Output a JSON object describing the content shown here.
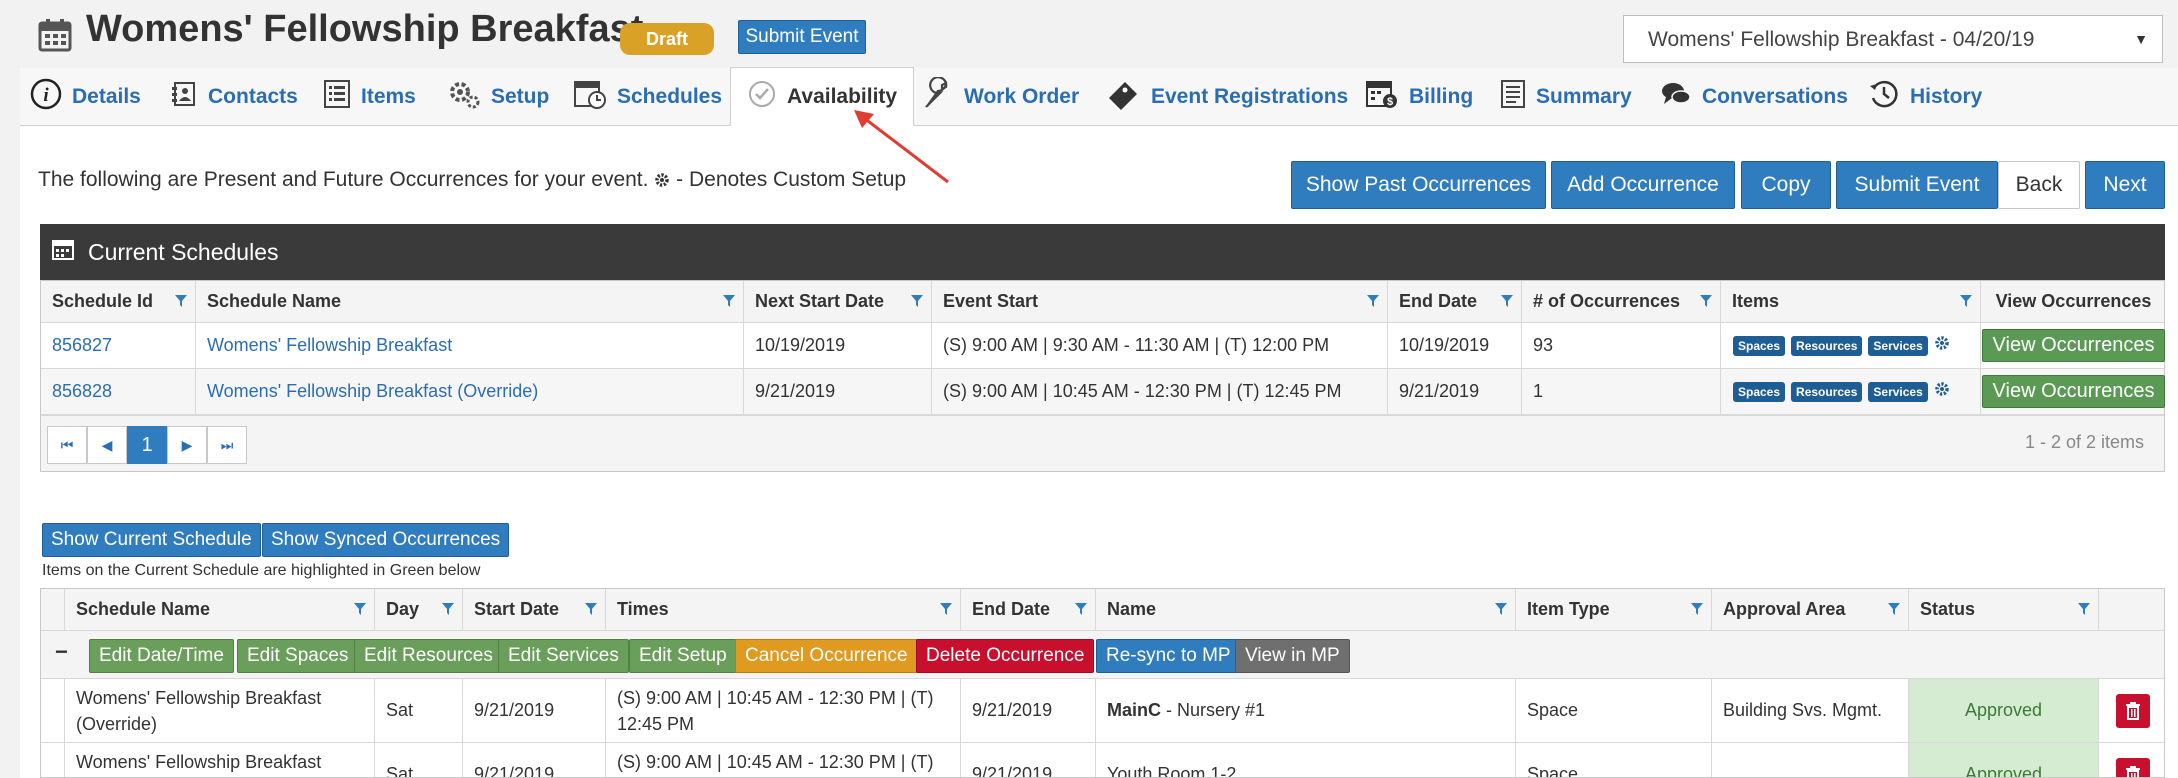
{
  "header": {
    "title": "Womens' Fellowship Breakfast",
    "badge": "Draft",
    "submit_label": "Submit Event",
    "occurrence_select": "Womens' Fellowship Breakfast - 04/20/19"
  },
  "tabs": [
    {
      "label": "Details",
      "icon": "info-icon"
    },
    {
      "label": "Contacts",
      "icon": "contacts-icon"
    },
    {
      "label": "Items",
      "icon": "list-icon"
    },
    {
      "label": "Setup",
      "icon": "gears-icon"
    },
    {
      "label": "Schedules",
      "icon": "calendar-clock-icon"
    },
    {
      "label": "Availability",
      "icon": "check-clock-icon",
      "active": true
    },
    {
      "label": "Work Order",
      "icon": "wrench-icon"
    },
    {
      "label": "Event Registrations",
      "icon": "ticket-icon"
    },
    {
      "label": "Billing",
      "icon": "calendar-dollar-icon"
    },
    {
      "label": "Summary",
      "icon": "document-icon"
    },
    {
      "label": "Conversations",
      "icon": "chat-icon"
    },
    {
      "label": "History",
      "icon": "history-icon"
    }
  ],
  "intro_text": "The following are Present and Future Occurrences for your event.",
  "intro_suffix": "- Denotes Custom Setup",
  "action_buttons": {
    "show_past": "Show Past Occurrences",
    "add": "Add Occurrence",
    "copy": "Copy",
    "submit": "Submit Event",
    "back": "Back",
    "next": "Next"
  },
  "current_schedules": {
    "title": "Current Schedules",
    "columns": [
      "Schedule Id",
      "Schedule Name",
      "Next Start Date",
      "Event Start",
      "End Date",
      "# of Occurrences",
      "Items",
      "View Occurrences"
    ],
    "item_chips": [
      "Spaces",
      "Resources",
      "Services"
    ],
    "view_label": "View Occurrences",
    "rows": [
      {
        "id": "856827",
        "name": "Womens' Fellowship Breakfast",
        "next_start": "10/19/2019",
        "event_start": "(S) 9:00 AM | 9:30 AM - 11:30 AM | (T) 12:00 PM",
        "end_date": "10/19/2019",
        "occurrences": "93"
      },
      {
        "id": "856828",
        "name": "Womens' Fellowship Breakfast (Override)",
        "next_start": "9/21/2019",
        "event_start": "(S) 9:00 AM | 10:45 AM - 12:30 PM | (T) 12:45 PM",
        "end_date": "9/21/2019",
        "occurrences": "1"
      }
    ],
    "current_page": "1",
    "items_count": "1 - 2 of 2 items"
  },
  "lower": {
    "show_current": "Show Current Schedule",
    "show_synced": "Show Synced Occurrences",
    "note": "Items on the Current Schedule are highlighted in Green below",
    "columns": [
      "Schedule Name",
      "Day",
      "Start Date",
      "Times",
      "End Date",
      "Name",
      "Item Type",
      "Approval Area",
      "Status"
    ],
    "collapse_symbol": "−",
    "actions": [
      "Edit Date/Time",
      "Edit Spaces",
      "Edit Resources",
      "Edit Services",
      "Edit Setup",
      "Cancel Occurrence",
      "Delete Occurrence",
      "Re-sync to MP",
      "View in MP"
    ],
    "rows": [
      {
        "schedule_name": "Womens' Fellowship Breakfast (Override)",
        "day": "Sat",
        "start_date": "9/21/2019",
        "times": "(S) 9:00 AM | 10:45 AM - 12:30 PM | (T) 12:45 PM",
        "end_date": "9/21/2019",
        "name_bold": "MainC",
        "name_rest": " - Nursery #1",
        "item_type": "Space",
        "approval_area": "Building Svs. Mgmt.",
        "status": "Approved"
      },
      {
        "schedule_name": "Womens' Fellowship Breakfast",
        "day": "Sat",
        "start_date": "9/21/2019",
        "times": "(S) 9:00 AM | 10:45 AM - 12:30 PM | (T)",
        "end_date": "9/21/2019",
        "name_bold": "",
        "name_rest": "Youth Room 1-2",
        "item_type": "Space",
        "approval_area": "",
        "status": "Approved"
      }
    ]
  },
  "colors": {
    "primary": "#2f7cbf",
    "draft": "#d9a227",
    "header_dark": "#3a3a3a",
    "green": "#6a9e5b",
    "orange": "#e19a20",
    "red": "#c8102e",
    "approved_bg": "#d6ecd2"
  }
}
